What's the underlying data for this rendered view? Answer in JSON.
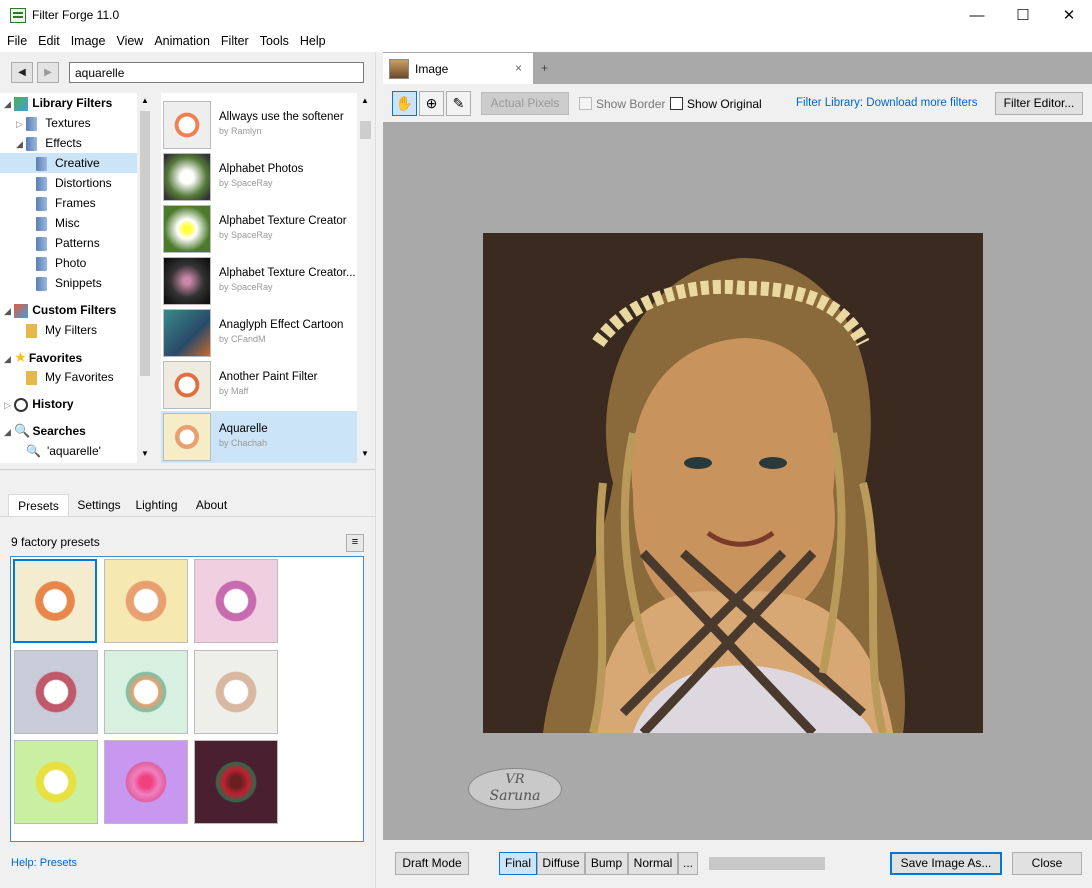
{
  "window": {
    "title": "Filter Forge 11.0",
    "minimize": "—",
    "maximize": "☐",
    "close": "✕"
  },
  "menu": [
    "File",
    "Edit",
    "Image",
    "View",
    "Animation",
    "Filter",
    "Tools",
    "Help"
  ],
  "search": {
    "value": "aquarelle"
  },
  "tree": {
    "library_filters": "Library Filters",
    "textures": "Textures",
    "effects": "Effects",
    "creative": "Creative",
    "distortions": "Distortions",
    "frames": "Frames",
    "misc": "Misc",
    "patterns": "Patterns",
    "photo": "Photo",
    "snippets": "Snippets",
    "custom_filters": "Custom Filters",
    "my_filters": "My Filters",
    "favorites": "Favorites",
    "my_favorites": "My Favorites",
    "history": "History",
    "searches": "Searches",
    "search_item": "'aquarelle'"
  },
  "filters": [
    {
      "name": "Allways use the softener",
      "author": "by Ramlyn"
    },
    {
      "name": "Alphabet Photos",
      "author": "by SpaceRay"
    },
    {
      "name": "Alphabet Texture Creator",
      "author": "by SpaceRay"
    },
    {
      "name": "Alphabet Texture Creator...",
      "author": "by SpaceRay"
    },
    {
      "name": "Anaglyph Effect Cartoon",
      "author": "by CFandM"
    },
    {
      "name": "Another Paint Filter",
      "author": "by Maff"
    },
    {
      "name": "Aquarelle",
      "author": "by Chachah"
    }
  ],
  "panel_tabs": {
    "presets": "Presets",
    "settings": "Settings",
    "lighting": "Lighting",
    "about": "About"
  },
  "presets": {
    "count_label": "9 factory presets",
    "help_link": "Help: Presets"
  },
  "doc_tab": {
    "label": "Image",
    "close": "×",
    "add": "+"
  },
  "toolbar": {
    "actual_pixels": "Actual Pixels",
    "show_border": "Show Border",
    "show_original": "Show Original",
    "library_link": "Filter Library: Download more filters",
    "filter_editor": "Filter Editor..."
  },
  "bottom": {
    "draft_mode": "Draft Mode",
    "final": "Final",
    "diffuse": "Diffuse",
    "bump": "Bump",
    "normal": "Normal",
    "more": "...",
    "save_image": "Save Image As...",
    "close": "Close"
  },
  "watermark": {
    "line1": "VR",
    "line2": "Saruna"
  }
}
